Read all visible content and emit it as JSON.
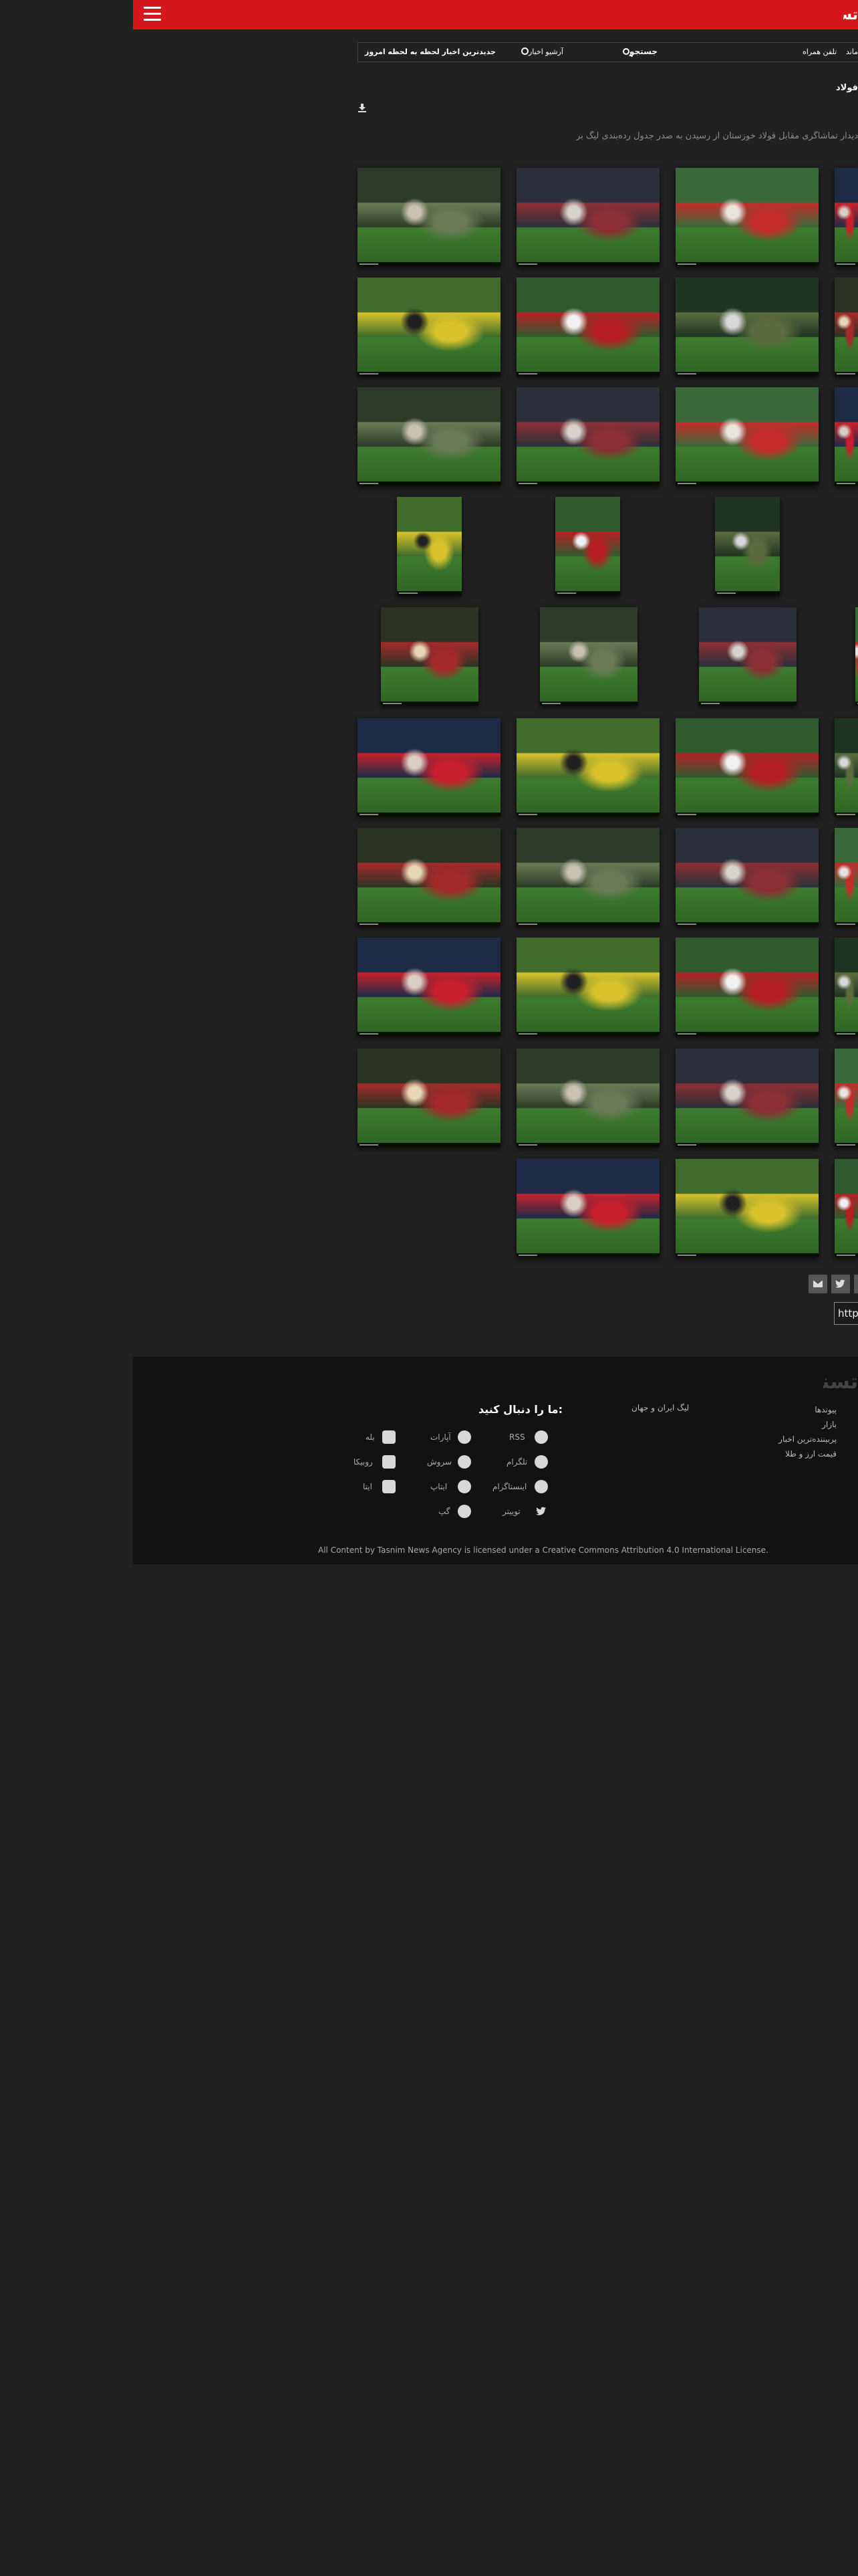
{
  "header": {
    "logo_text": "تسنیم",
    "menu_icon": "hamburger-icon",
    "brand_color": "#d4161d"
  },
  "subnav": {
    "latest_news": "جدیدترین اخبار لحظه به لحظه امروز",
    "archive": "آرشیو اخبار",
    "archive_icon": "clock-icon",
    "search": "جستجو",
    "search_icon": "search-icon",
    "mobile": "تلفن همراه",
    "cut_item": "ماند"
  },
  "article": {
    "title": "فولاد",
    "lead": "دیدار تماشاگری مقابل فولاد خوزستان از رسیدن به صدر جدول رده‌بندی لیگ برتر بازماند.",
    "download_icon": "download-icon"
  },
  "share": {
    "email_icon": "email-icon",
    "twitter_icon": "twitter-icon",
    "url_value": "https://"
  },
  "footer": {
    "logo_text": "تسنیم",
    "links": [
      "پیوندها",
      "بازار",
      "پربیننده‌ترین اخبار",
      "قیمت ارز و طلا"
    ],
    "league_link": "لیگ ایران و جهان",
    "follow_title": "ما را دنبال کنید:",
    "social": [
      {
        "label": "RSS",
        "icon": "rss-icon"
      },
      {
        "label": "آپارات",
        "icon": "aparat-icon"
      },
      {
        "label": "بله",
        "icon": "bale-icon"
      },
      {
        "label": "تلگرام",
        "icon": "telegram-icon"
      },
      {
        "label": "سروش",
        "icon": "soroush-icon"
      },
      {
        "label": "روبیکا",
        "icon": "rubika-icon"
      },
      {
        "label": "اینستاگرام",
        "icon": "instagram-icon"
      },
      {
        "label": "ایتاپ",
        "icon": "eitaa-icon"
      },
      {
        "label": "ایتا",
        "icon": "eita-icon"
      },
      {
        "label": "توییتر",
        "icon": "twitter-icon"
      },
      {
        "label": "گپ",
        "icon": "gap-icon"
      }
    ],
    "license": "All Content by Tasnim News Agency is licensed under a Creative Commons Attribution 4.0 International License."
  }
}
